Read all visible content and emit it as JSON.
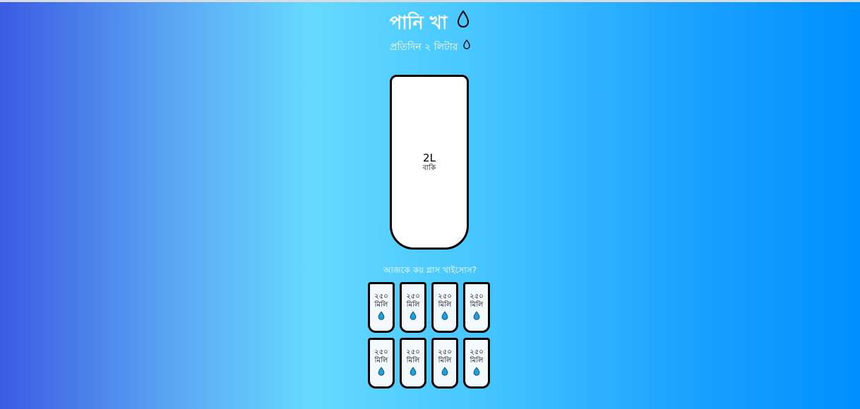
{
  "header": {
    "title": "পানি খা",
    "title_icon": "water-drop-icon",
    "subtitle": "প্রতিদিন ২ লিটার",
    "subtitle_icon": "water-drop-icon"
  },
  "big_cup": {
    "remaining_amount": "2L",
    "remaining_label": "বাকি",
    "filled_fraction": 0
  },
  "question": "আজকে কয় গ্লাস খাইসোস?",
  "small_cups": [
    {
      "size": "২৫০",
      "unit": "মিলি",
      "icon": "water-drop-icon",
      "filled": false
    },
    {
      "size": "২৫০",
      "unit": "মিলি",
      "icon": "water-drop-icon",
      "filled": false
    },
    {
      "size": "২৫০",
      "unit": "মিলি",
      "icon": "water-drop-icon",
      "filled": false
    },
    {
      "size": "২৫০",
      "unit": "মিলি",
      "icon": "water-drop-icon",
      "filled": false
    },
    {
      "size": "২৫০",
      "unit": "মিলি",
      "icon": "water-drop-icon",
      "filled": false
    },
    {
      "size": "২৫০",
      "unit": "মিলি",
      "icon": "water-drop-icon",
      "filled": false
    },
    {
      "size": "২৫০",
      "unit": "মিলি",
      "icon": "water-drop-icon",
      "filled": false
    },
    {
      "size": "২৫০",
      "unit": "মিলি",
      "icon": "water-drop-icon",
      "filled": false
    }
  ],
  "colors": {
    "drop_fill": "#1d9fd8",
    "cup_border": "#000000",
    "cup_background": "#ffffff",
    "small_cup_background": "#f3f9fd"
  }
}
